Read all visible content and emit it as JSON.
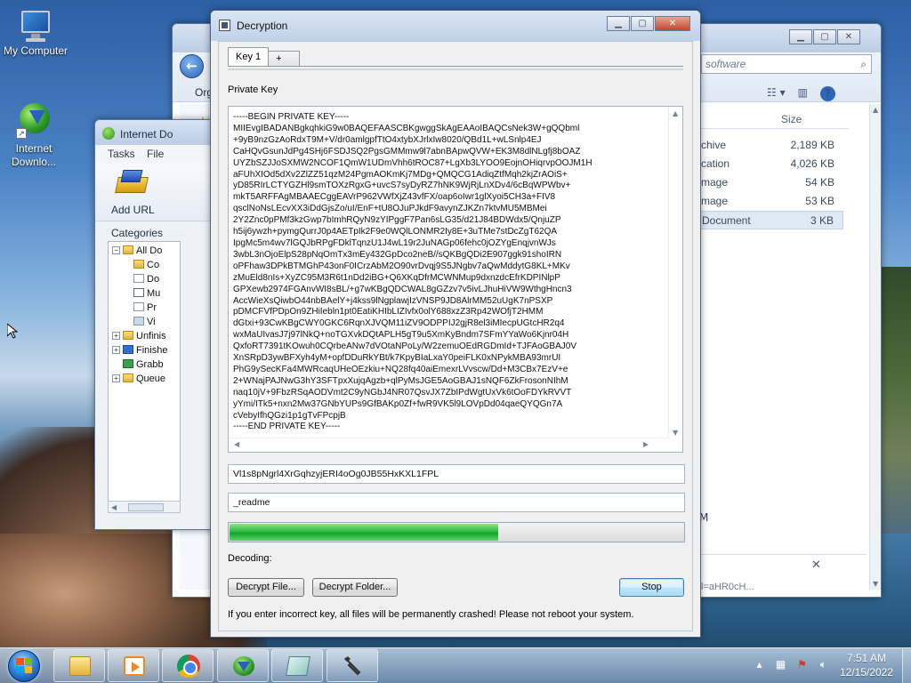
{
  "desktop": {
    "icons": [
      {
        "label": "My Computer"
      },
      {
        "label": "Internet Downlo..."
      }
    ]
  },
  "explorer": {
    "search_placeholder": "software",
    "organize_label": "Org",
    "size_header": "Size",
    "rows": [
      {
        "type": "chive",
        "size": "2,189 KB"
      },
      {
        "type": "cation",
        "size": "4,026 KB"
      },
      {
        "type": "mage",
        "size": "54 KB"
      },
      {
        "type": "mage",
        "size": "53 KB"
      },
      {
        "type": "Document",
        "size": "3 KB"
      }
    ],
    "status_letter": "M",
    "bottom_hint": "l=aHR0cH..."
  },
  "idm": {
    "title": "Internet Do",
    "menu": {
      "tasks": "Tasks",
      "file": "File"
    },
    "add_url": "Add URL",
    "categories_label": "Categories",
    "tree": [
      {
        "label": "All Do",
        "expander": "−"
      },
      {
        "label": "Co"
      },
      {
        "label": "Do"
      },
      {
        "label": "Mu"
      },
      {
        "label": "Pr"
      },
      {
        "label": "Vi"
      },
      {
        "label": "Unfinis",
        "expander": "+"
      },
      {
        "label": "Finishe",
        "expander": "+"
      },
      {
        "label": "Grabb"
      },
      {
        "label": "Queue",
        "expander": "+"
      }
    ]
  },
  "dialog": {
    "title": "Decryption",
    "tabs": [
      "Key 1",
      "+"
    ],
    "private_key_label": "Private Key",
    "key_lines": [
      "-----BEGIN PRIVATE KEY-----",
      "MIIEvgIBADANBgkqhkiG9w0BAQEFAASCBKgwggSkAgEAAoIBAQCsNek3W+gQQbml",
      "+9yB9nzGzAoRdxT9M+V/dr0amlgpfTtO4xtybXJrlxIw8020/QBd1L+wLSnlp4EJ",
      "CaHQvGsunJdPg4SHj6FSDJSQ2PgsGMMmw9l7abnBApwQVW+EK3M8dlNLgfj8bOAZ",
      "UYZbSZJJoSXMW2NCOF1QmW1UDmVhh6tROC87+LgXb3LYOO9EojnOHiqrvpOOJM1H",
      "aFUhXIOd5dXv2ZlZZ51qzM24PgmAOKmKj7MDg+QMQCG1AdiqZtfMqh2kjZrAOiS+",
      "yD85RIrLCTYGZHl9smTOXzRgxG+uvcS7syDyRZ7hNK9WjRjLnXDv4/6cBqWPWbv+",
      "mkT5ARFFAgMBAAECggEAVrP962VWfXjZ43vfFX/oap6oIwr1glXyoi5CH3a+FIV8",
      "qsclNoNsLEcvXX3iDdGjsZo/uI/EnF+tU8OJuPJkdF9avynZJKZn7ktvMU5MBMei",
      "2Y2Znc0pPMf3kzGwp7bImhRQyN9zYIPggF7Pan6sLG35/d21J84BDWdx5/QnjuZP",
      "h5ij6ywzh+pymgQurrJ0p4AETpIk2F9e0WQlLONMR2Iy8E+3uTMe7stDcZgT62QA",
      "IpgMc5m4wv7lGQJbRPgFDklTqnzU1J4wL19r2JuNAGp06fehc0jOZYgEnqjvnWJs",
      "3wbL3nOjoElpS28pNqOmTx3mEy432GpDco2neB//sQKBgQDi2E907ggk91shoIRN",
      "oPFhaw3DPkBTMGhP43onF0ICrzAbM2O90vrDvqj9S5JNgbv7aQwMddytG8KL+MKv",
      "zMuEld8nIs+XyZC95M3R6t1nDd2iBG+Q6XKqDfrMCWNMup9dxnzdcEfrKDPINlpP",
      "GPXewb2974FGAnvWI8sBL/+g7wKBgQDCWAL8gGZzv7v5ivLJhuHiVW9WthgHncn3",
      "AccWieXsQiwbO44nbBAelY+j4kss9lNgplawjIzVNSP9JD8AlrMM52uUgK7nPSXP",
      "pDMCFVfPDpOn9ZHiIebln1pt0EatiKHIbLIZIvfx0olY688xzZ3Rp42WOfjT2HMM",
      "dGtxi+93CwKBgCWY0GKC6RqnXJVQM11iZV9ODPPIJ2gjR8el3iMIecpUGtcHR2q4",
      "wxMaUIvasJ7j97lNkQ+noTGXvkDQtAPLH5gT9u5XmKyBndm7SFmYYaWo6Kjnr04H",
      "QxfoRT7391tKOwuh0CQrbeANw7dVOtaNPoLy/W2zemuOEdRGDmId+TJFAoGBAJ0V",
      "XnSRpD3ywBFXyh4yM+opfDDuRkYBt/k7KpyBIaLxaY0peiFLK0xNPykMBA93mrUI",
      "PhG9ySecKFa4MWRcaqUHeOEzkiu+NQ28fq40aiEmexrLVvscw/Dd+M3CBx7EzV+e",
      "2+WNajPAJNwG3hY3SFTpxXujqAgzb+qlPyMsJGE5AoGBAJ1sNQF6ZkFrosonNIhM",
      "naq10jV+9FbzRSqAODVmt2C9yNGbJ4NR07QsvJX7ZbIPdWgtUxVk6tOoFDYkRVVT",
      "yYmi/ITk5+nxn2Mw37GNbYUPs9GfBAKp0Zf+fwR9VK5l9LOVpDd04qaeQYQGn7A",
      "cVebyIfhQGzi1p1gTvFPcpjB",
      "-----END PRIVATE KEY-----"
    ],
    "key_id": "Vl1s8pNgrl4XrGqhzyjERI4oOg0JB55HxKXL1FPL",
    "extension": "_readme",
    "progress": 0.59,
    "status_label": "Decoding:",
    "buttons": {
      "decrypt_file": "Decrypt File...",
      "decrypt_folder": "Decrypt Folder...",
      "stop": "Stop"
    },
    "warning": "If you enter incorrect key, all files will be permanently crashed! Please not reboot your system."
  },
  "taskbar": {
    "apps": [
      "explorer-icon",
      "media-player-icon",
      "chrome-icon",
      "idm-icon",
      "app-icon",
      "tool-icon"
    ],
    "clock": {
      "time": "7:51 AM",
      "date": "12/15/2022"
    }
  }
}
